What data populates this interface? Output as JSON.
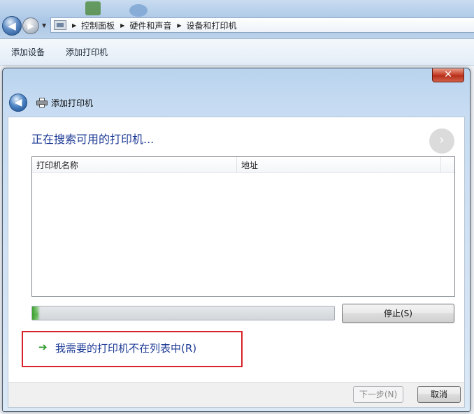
{
  "explorer": {
    "breadcrumb": [
      "控制面板",
      "硬件和声音",
      "设备和打印机"
    ],
    "toolbar": {
      "add_device": "添加设备",
      "add_printer": "添加打印机"
    }
  },
  "dialog": {
    "title": "添加打印机",
    "close_symbol": "✕",
    "heading": "正在搜索可用的打印机...",
    "list": {
      "columns": [
        "打印机名称",
        "地址"
      ],
      "rows": []
    },
    "progress": 0.02,
    "stop_button": "停止(S)",
    "link_text": "我需要的打印机不在列表中(R)",
    "next_button": "下一步(N)",
    "cancel_button": "取消"
  },
  "icons": {
    "back": "back-arrow-icon",
    "forward": "forward-arrow-icon",
    "printer": "printer-icon",
    "link_arrow": "green-arrow-icon",
    "close": "close-icon"
  },
  "colors": {
    "heading": "#1e3b95",
    "highlight_box": "#d8232a",
    "progress_fill": "#7cc272",
    "close_button": "#c9452e"
  }
}
